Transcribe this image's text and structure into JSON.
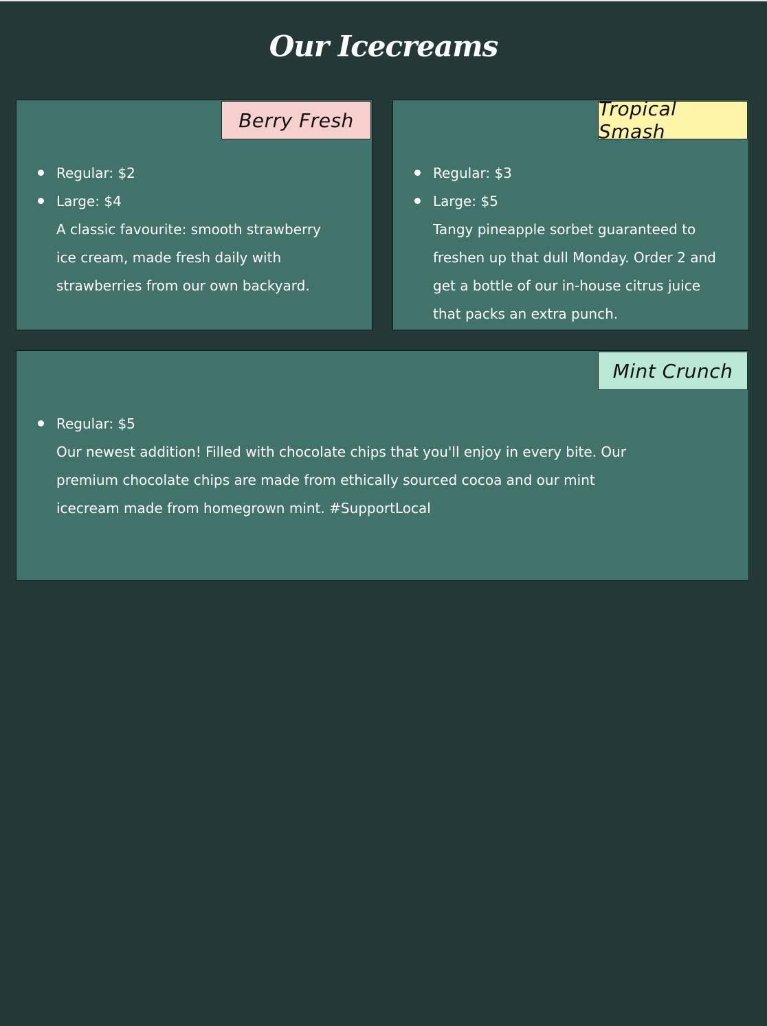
{
  "page": {
    "title": "Our Icecreams"
  },
  "colors": {
    "background": "#243937",
    "card": "#42736b",
    "berry_tag": "#f6d0ce",
    "tropical_tag": "#fff5a8",
    "mint_tag": "#b9e8d4"
  },
  "cards": [
    {
      "name": "Berry Fresh",
      "prices": [
        "Regular: $2",
        "Large: $4"
      ],
      "description": "A classic favourite: smooth strawberry ice cream, made fresh daily with strawberries from our own backyard."
    },
    {
      "name": "Tropical Smash",
      "prices": [
        "Regular: $3",
        "Large: $5"
      ],
      "description": "Tangy pineapple sorbet guaranteed to freshen up that dull Monday. Order 2 and get a bottle of our in-house citrus juice that packs an extra punch."
    },
    {
      "name": "Mint Crunch",
      "prices": [
        "Regular: $5"
      ],
      "description": "Our newest addition! Filled with chocolate chips that you'll enjoy in every bite. Our premium chocolate chips are made from ethically sourced cocoa and our mint icecream made from homegrown mint. #SupportLocal"
    }
  ]
}
